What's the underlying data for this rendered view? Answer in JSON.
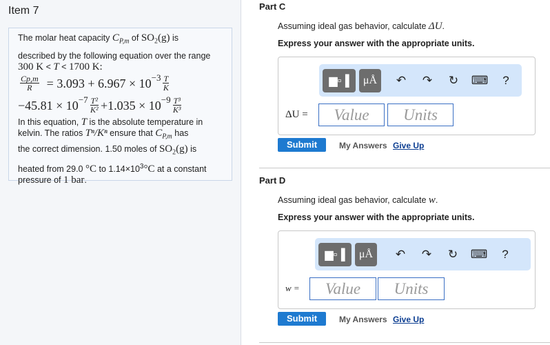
{
  "item_title": "Item 7",
  "problem": {
    "l1a": "The molar heat capacity ",
    "cpm": "C",
    "cpm_sub": "P,m",
    "l1b": " of ",
    "so2": "SO",
    "so2_sub": "2",
    "g": "(g)",
    "l1c": " is",
    "l2": "described by the following equation over the range",
    "l3a": "300 K",
    "l3b": " < ",
    "T": "T",
    "l3c": " < ",
    "l3d": "1700 K:",
    "eq1_lhs_num": "Cp,m",
    "eq1_lhs_den": "R",
    "eq1": "= 3.093 + 6.967 × 10",
    "eq1_exp": "−3",
    "f1n": "T",
    "f1d": "K",
    "eq2a": "−45.81 × 10",
    "eq2a_exp": "−7",
    "f2n": "T²",
    "f2d": "K²",
    "eq2b": "+1.035 × 10",
    "eq2b_exp": "−9",
    "f3n": "T³",
    "f3d": "K³",
    "l4a": "In this equation, ",
    "l4b": " is the absolute temperature in",
    "l5a": "kelvin. The ratios ",
    "ratio": "Tⁿ/Kⁿ",
    "l5b": " ensure that ",
    "l5c": " has",
    "l6a": "the correct dimension. 1.50 moles of ",
    "l6b": " is",
    "l7a": "heated from 29.0 ",
    "deg": "°C",
    "l7b": " to 1.14×10",
    "l7exp": "3",
    "l7c": " at a constant",
    "l8a": "pressure of ",
    "l8b": "1 bar",
    "l8c": "."
  },
  "parts": [
    {
      "title": "Part C",
      "prompt": "Assuming ideal gas behavior, calculate ",
      "var": "ΔU",
      "period": ".",
      "instr": "Express your answer with the appropriate units.",
      "label": "ΔU =",
      "value_ph": "Value",
      "units_ph": "Units",
      "units_btn": "μÅ",
      "help": "?",
      "submit": "Submit",
      "my_answers": "My Answers",
      "give_up": "Give Up"
    },
    {
      "title": "Part D",
      "prompt": "Assuming ideal gas behavior, calculate ",
      "var": "w",
      "period": ".",
      "instr": "Express your answer with the appropriate units.",
      "label": "w =",
      "value_ph": "Value",
      "units_ph": "Units",
      "units_btn": "μÅ",
      "help": "?",
      "submit": "Submit",
      "my_answers": "My Answers",
      "give_up": "Give Up"
    }
  ]
}
